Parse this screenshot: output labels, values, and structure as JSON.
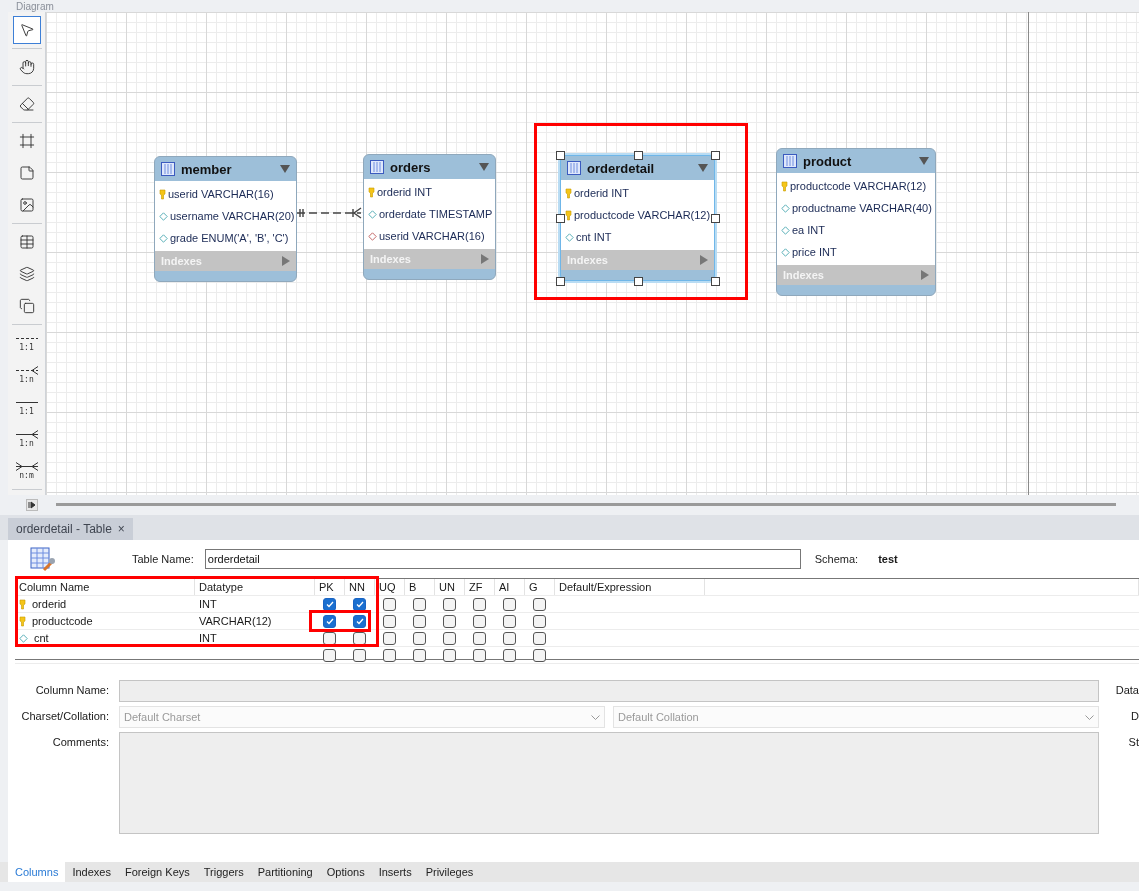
{
  "diagram": {
    "title": "Diagram",
    "toolbar": [
      [
        {
          "kind": "pointer",
          "selected": true
        }
      ],
      [
        {
          "kind": "hand",
          "selected": false
        }
      ],
      [
        {
          "kind": "eraser",
          "selected": false
        }
      ],
      [
        {
          "kind": "layer",
          "selected": false
        },
        {
          "kind": "note",
          "selected": false
        },
        {
          "kind": "image",
          "selected": false
        }
      ],
      [
        {
          "kind": "table",
          "selected": false
        },
        {
          "kind": "view",
          "selected": false
        },
        {
          "kind": "routine",
          "selected": false
        }
      ],
      [
        {
          "kind": "onetoone",
          "dashed": true,
          "label": "1:1",
          "selected": false
        },
        {
          "kind": "onetomany",
          "dashed": true,
          "label": "1:n",
          "selected": false
        },
        {
          "kind": "onetoone",
          "dashed": false,
          "label": "1:1",
          "selected": false
        },
        {
          "kind": "onetomany",
          "dashed": false,
          "label": "1:n",
          "selected": false
        },
        {
          "kind": "manytomany",
          "dashed": false,
          "label": "n:m",
          "selected": false
        }
      ]
    ],
    "tables": [
      {
        "name": "member",
        "selected": false,
        "highlighted": false,
        "indexes_label": "Indexes",
        "columns": [
          {
            "kind": "pk",
            "text": "userid VARCHAR(16)"
          },
          {
            "kind": "col",
            "text": "username VARCHAR(20)"
          },
          {
            "kind": "col",
            "text": "grade ENUM('A', 'B', 'C')"
          }
        ]
      },
      {
        "name": "orders",
        "selected": false,
        "highlighted": false,
        "indexes_label": "Indexes",
        "columns": [
          {
            "kind": "pk",
            "text": "orderid INT"
          },
          {
            "kind": "col",
            "text": "orderdate TIMESTAMP"
          },
          {
            "kind": "fk",
            "text": "userid VARCHAR(16)"
          }
        ]
      },
      {
        "name": "orderdetail",
        "selected": true,
        "highlighted": true,
        "indexes_label": "Indexes",
        "columns": [
          {
            "kind": "pk",
            "text": "orderid INT"
          },
          {
            "kind": "pk",
            "text": "productcode VARCHAR(12)"
          },
          {
            "kind": "col",
            "text": "cnt INT"
          }
        ]
      },
      {
        "name": "product",
        "selected": false,
        "highlighted": false,
        "indexes_label": "Indexes",
        "columns": [
          {
            "kind": "pk",
            "text": "productcode VARCHAR(12)"
          },
          {
            "kind": "col",
            "text": "productname VARCHAR(40)"
          },
          {
            "kind": "col",
            "text": "ea INT"
          },
          {
            "kind": "col",
            "text": "price INT"
          }
        ]
      }
    ]
  },
  "editor": {
    "tab": {
      "title": "orderdetail - Table",
      "close": "×"
    },
    "table_name_label": "Table Name:",
    "table_name": "orderdetail",
    "schema_label": "Schema:",
    "schema": "test",
    "grid": {
      "highlighted": true,
      "headers": [
        "Column Name",
        "Datatype",
        "PK",
        "NN",
        "UQ",
        "B",
        "UN",
        "ZF",
        "AI",
        "G",
        "Default/Expression"
      ],
      "rows": [
        {
          "kind": "pk",
          "name": "orderid",
          "datatype": "INT",
          "highlighted": false,
          "checks": [
            {
              "checked": true
            },
            {
              "checked": true
            },
            {
              "checked": false
            },
            {
              "checked": false
            },
            {
              "checked": false
            },
            {
              "checked": false
            },
            {
              "checked": false
            },
            {
              "checked": false
            }
          ]
        },
        {
          "kind": "pk",
          "name": "productcode",
          "datatype": "VARCHAR(12)",
          "highlighted": true,
          "checks": [
            {
              "checked": true
            },
            {
              "checked": true
            },
            {
              "checked": false
            },
            {
              "checked": false
            },
            {
              "checked": false
            },
            {
              "checked": false
            },
            {
              "checked": false
            },
            {
              "checked": false
            }
          ]
        },
        {
          "kind": "col",
          "name": "cnt",
          "datatype": "INT",
          "highlighted": false,
          "checks": [
            {
              "checked": false
            },
            {
              "checked": false
            },
            {
              "checked": false
            },
            {
              "checked": false
            },
            {
              "checked": false
            },
            {
              "checked": false
            },
            {
              "checked": false
            },
            {
              "checked": false
            }
          ]
        },
        {
          "kind": "new",
          "highlighted": false,
          "checks": [
            {
              "checked": false
            },
            {
              "checked": false
            },
            {
              "checked": false
            },
            {
              "checked": false
            },
            {
              "checked": false
            },
            {
              "checked": false
            },
            {
              "checked": false
            },
            {
              "checked": false
            }
          ]
        }
      ]
    },
    "details": {
      "column_name_label": "Column Name:",
      "charset_label": "Charset/Collation:",
      "charset": "Default Charset",
      "collation": "Default Collation",
      "comments_label": "Comments:",
      "side_labels": [
        "Data",
        "D",
        "St"
      ]
    },
    "bottom_tabs": [
      {
        "label": "Columns",
        "selected": true
      },
      {
        "label": "Indexes",
        "selected": false
      },
      {
        "label": "Foreign Keys",
        "selected": false
      },
      {
        "label": "Triggers",
        "selected": false
      },
      {
        "label": "Partitioning",
        "selected": false
      },
      {
        "label": "Options",
        "selected": false
      },
      {
        "label": "Inserts",
        "selected": false
      },
      {
        "label": "Privileges",
        "selected": false
      }
    ]
  }
}
